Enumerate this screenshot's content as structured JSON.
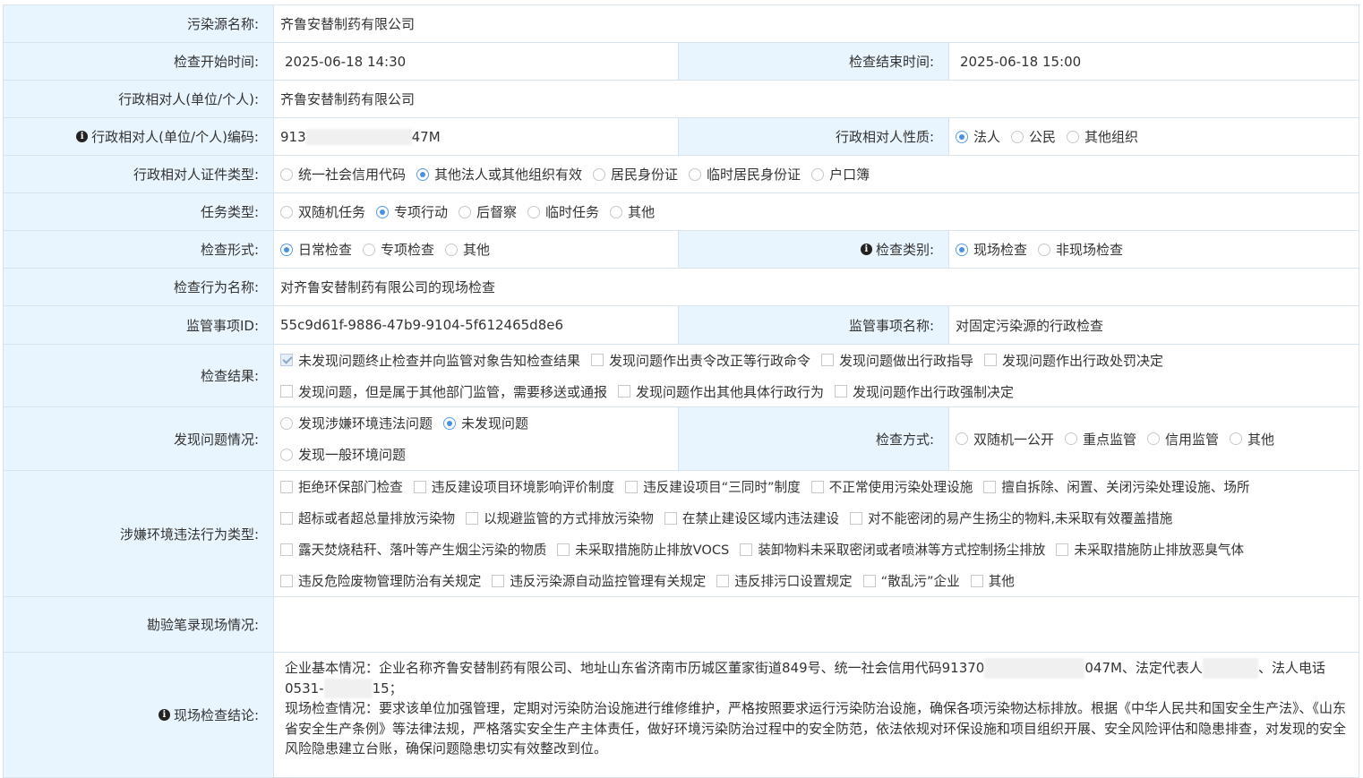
{
  "rows": {
    "pollution_source": {
      "label": "污染源名称:",
      "value": "齐鲁安替制药有限公司"
    },
    "check_start": {
      "label": "检查开始时间:",
      "value": "2025-06-18 14:30"
    },
    "check_end": {
      "label": "检查结束时间:",
      "value": "2025-06-18 15:00"
    },
    "admin_party": {
      "label": "行政相对人(单位/个人):",
      "value": "齐鲁安替制药有限公司"
    },
    "admin_code": {
      "label": "行政相对人(单位/个人)编码:",
      "value_prefix": "913",
      "value_suffix": "47M"
    },
    "admin_nature": {
      "label": "行政相对人性质:",
      "options": [
        "法人",
        "公民",
        "其他组织"
      ],
      "selected": "法人"
    },
    "cert_type": {
      "label": "行政相对人证件类型:",
      "options": [
        "统一社会信用代码",
        "其他法人或其他组织有效",
        "居民身份证",
        "临时居民身份证",
        "户口簿"
      ],
      "selected": "其他法人或其他组织有效"
    },
    "task_type": {
      "label": "任务类型:",
      "options": [
        "双随机任务",
        "专项行动",
        "后督察",
        "临时任务",
        "其他"
      ],
      "selected": "专项行动"
    },
    "check_form": {
      "label": "检查形式:",
      "options": [
        "日常检查",
        "专项检查",
        "其他"
      ],
      "selected": "日常检查"
    },
    "check_category": {
      "label": "检查类别:",
      "options": [
        "现场检查",
        "非现场检查"
      ],
      "selected": "现场检查"
    },
    "check_action_name": {
      "label": "检查行为名称:",
      "value": "对齐鲁安替制药有限公司的现场检查"
    },
    "item_id": {
      "label": "监管事项ID:",
      "value": "55c9d61f-9886-47b9-9104-5f612465d8e6"
    },
    "item_name": {
      "label": "监管事项名称:",
      "value": "对固定污染源的行政检查"
    },
    "check_result": {
      "label": "检查结果:",
      "line1": [
        "未发现问题终止检查并向监管对象告知检查结果",
        "发现问题作出责令改正等行政命令",
        "发现问题做出行政指导",
        "发现问题作出行政处罚决定"
      ],
      "line2": [
        "发现问题，但是属于其他部门监管，需要移送或通报",
        "发现问题作出其他具体行政行为",
        "发现问题作出行政强制决定"
      ],
      "checked": "未发现问题终止检查并向监管对象告知检查结果"
    },
    "problem_found": {
      "label": "发现问题情况:",
      "line1": [
        "发现涉嫌环境违法问题",
        "未发现问题"
      ],
      "line2": [
        "发现一般环境问题"
      ],
      "selected": "未发现问题"
    },
    "check_method": {
      "label": "检查方式:",
      "options": [
        "双随机一公开",
        "重点监管",
        "信用监管",
        "其他"
      ]
    },
    "violation_type": {
      "label": "涉嫌环境违法行为类型:",
      "line1": [
        "拒绝环保部门检查",
        "违反建设项目环境影响评价制度",
        "违反建设项目“三同时”制度",
        "不正常使用污染处理设施",
        "擅自拆除、闲置、关闭污染处理设施、场所"
      ],
      "line2": [
        "超标或者超总量排放污染物",
        "以规避监管的方式排放污染物",
        "在禁止建设区域内违法建设",
        "对不能密闭的易产生扬尘的物料,未采取有效覆盖措施"
      ],
      "line3": [
        "露天焚烧秸秆、落叶等产生烟尘污染的物质",
        "未采取措施防止排放VOCS",
        "装卸物料未采取密闭或者喷淋等方式控制扬尘排放",
        "未采取措施防止排放恶臭气体"
      ],
      "line4": [
        "违反危险废物管理防治有关规定",
        "违反污染源自动监控管理有关规定",
        "违反排污口设置规定",
        "“散乱污”企业",
        "其他"
      ]
    },
    "inspection_record": {
      "label": "勘验笔录现场情况:",
      "value": ""
    },
    "conclusion": {
      "label": "现场检查结论:",
      "p1a": "企业基本情况：企业名称齐鲁安替制药有限公司、地址山东省济南市历城区董家街道849号、统一社会信用代码91370",
      "p1b": "047M、法定代表人",
      "p1c": "、法人电话",
      "p1d": "0531-",
      "p1e": "15；",
      "p2": "现场检查情况：要求该单位加强管理，定期对污染防治设施进行维修维护，严格按照要求运行污染防治设施，确保各项污染物达标排放。根据《中华人民共和国安全生产法》、《山东省安全生产条例》等法律法规，严格落实安全生产主体责任，做好环境污染防治过程中的安全防范，依法依规对环保设施和项目组织开展、安全风险评估和隐患排查，对发现的安全风险隐患建立台账，确保问题隐患切实有效整改到位。"
    }
  },
  "icons": {
    "info": "info-circle-icon"
  }
}
